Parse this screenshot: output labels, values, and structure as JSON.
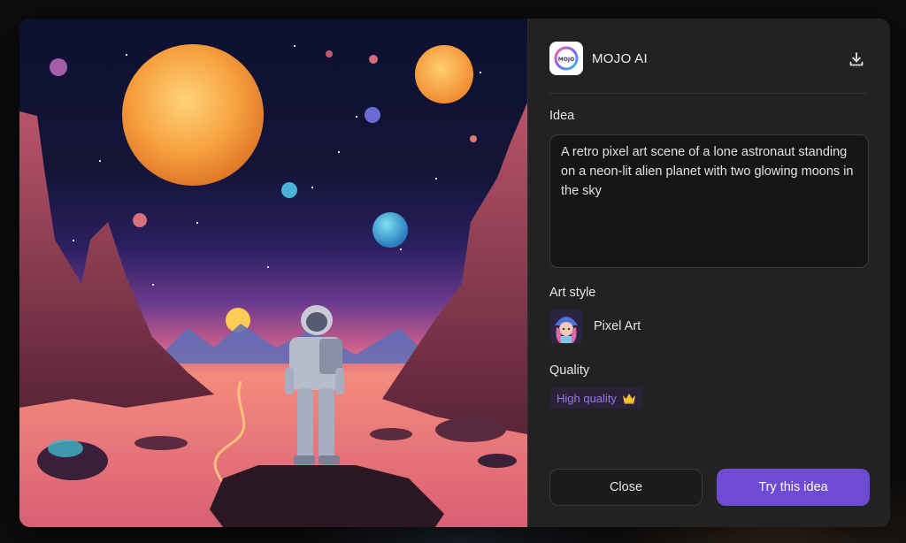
{
  "app": {
    "name": "MOJO AI",
    "logo_text": "MOJO"
  },
  "idea": {
    "label": "Idea",
    "text": "A retro pixel art scene of a lone astronaut standing on a neon-lit alien planet with two glowing moons in the sky"
  },
  "art_style": {
    "label": "Art style",
    "value": "Pixel Art"
  },
  "quality": {
    "label": "Quality",
    "value": "High quality",
    "icon": "crown-icon"
  },
  "actions": {
    "close_label": "Close",
    "try_label": "Try this idea"
  },
  "icons": {
    "download": "download-icon"
  },
  "colors": {
    "accent": "#6f4ad2",
    "quality_text": "#9a76e8",
    "panel_bg": "#222222"
  }
}
